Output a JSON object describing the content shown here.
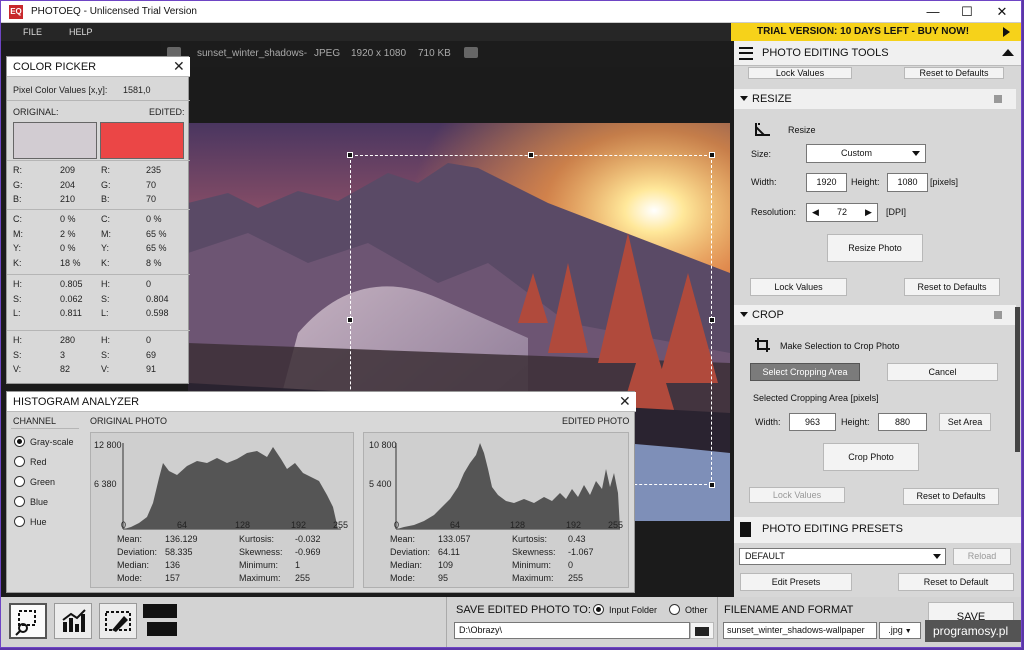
{
  "window": {
    "app_badge": "EQ",
    "title": "PHOTOEQ - Unlicensed Trial Version"
  },
  "menu": {
    "file": "FILE",
    "help": "HELP"
  },
  "trial_banner": "TRIAL VERSION: 10 DAYS LEFT - BUY NOW!",
  "file_info": {
    "name": "sunset_winter_shadows-",
    "format": "JPEG",
    "dimensions": "1920 x 1080",
    "size": "710 KB"
  },
  "color_picker": {
    "title": "COLOR PICKER",
    "pixel_label": "Pixel Color Values [x,y]:",
    "pixel_coords": "1581,0",
    "original_label": "ORIGINAL:",
    "edited_label": "EDITED:",
    "original_color": "#d2ccd2",
    "edited_color": "#eb4646",
    "groups": [
      [
        {
          "k": "R:",
          "o": "209",
          "e": "235"
        },
        {
          "k": "G:",
          "o": "204",
          "e": "70"
        },
        {
          "k": "B:",
          "o": "210",
          "e": "70"
        }
      ],
      [
        {
          "k": "C:",
          "o": "0 %",
          "e": "0 %"
        },
        {
          "k": "M:",
          "o": "2 %",
          "e": "65 %"
        },
        {
          "k": "Y:",
          "o": "0 %",
          "e": "65 %"
        },
        {
          "k": "K:",
          "o": "18 %",
          "e": "8 %"
        }
      ],
      [
        {
          "k": "H:",
          "o": "0.805",
          "e": "0"
        },
        {
          "k": "S:",
          "o": "0.062",
          "e": "0.804"
        },
        {
          "k": "L:",
          "o": "0.811",
          "e": "0.598"
        }
      ],
      [
        {
          "k": "H:",
          "o": "280",
          "e": "0"
        },
        {
          "k": "S:",
          "o": "3",
          "e": "69"
        },
        {
          "k": "V:",
          "o": "82",
          "e": "91"
        }
      ]
    ]
  },
  "histogram": {
    "title": "HISTOGRAM ANALYZER",
    "channel_label": "CHANNEL",
    "channels": [
      "Gray-scale",
      "Red",
      "Green",
      "Blue",
      "Hue"
    ],
    "selected_channel": "Gray-scale",
    "original_label": "ORIGINAL PHOTO",
    "edited_label": "EDITED PHOTO",
    "original": {
      "ymax": "12 800",
      "ymid": "6 380",
      "xticks": [
        "0",
        "64",
        "128",
        "192",
        "255"
      ],
      "stats": [
        [
          "Mean:",
          "136.129",
          "Kurtosis:",
          "-0.032"
        ],
        [
          "Deviation:",
          "58.335",
          "Skewness:",
          "-0.969"
        ],
        [
          "Median:",
          "136",
          "Minimum:",
          "1"
        ],
        [
          "Mode:",
          "157",
          "Maximum:",
          "255"
        ]
      ]
    },
    "edited": {
      "ymax": "10 800",
      "ymid": "5 400",
      "xticks": [
        "0",
        "64",
        "128",
        "192",
        "255"
      ],
      "stats": [
        [
          "Mean:",
          "133.057",
          "Kurtosis:",
          "0.43"
        ],
        [
          "Deviation:",
          "64.11",
          "Skewness:",
          "-1.067"
        ],
        [
          "Median:",
          "109",
          "Minimum:",
          "0"
        ],
        [
          "Mode:",
          "95",
          "Maximum:",
          "255"
        ]
      ]
    }
  },
  "tools_panel": {
    "title": "PHOTO EDITING TOOLS",
    "lock_values": "Lock Values",
    "reset_defaults": "Reset to Defaults",
    "resize": {
      "title": "RESIZE",
      "subtitle": "Resize",
      "size_label": "Size:",
      "size_value": "Custom",
      "width_label": "Width:",
      "width_value": "1920",
      "height_label": "Height:",
      "height_value": "1080",
      "unit": "[pixels]",
      "resolution_label": "Resolution:",
      "resolution_value": "72",
      "resolution_unit": "[DPI]",
      "action": "Resize Photo"
    },
    "crop": {
      "title": "CROP",
      "subtitle": "Make Selection to Crop Photo",
      "select_area": "Select Cropping Area",
      "cancel": "Cancel",
      "selected_label": "Selected Cropping Area [pixels]",
      "width_label": "Width:",
      "width_value": "963",
      "height_label": "Height:",
      "height_value": "880",
      "set_area": "Set Area",
      "action": "Crop Photo"
    }
  },
  "presets": {
    "title": "PHOTO EDITING PRESETS",
    "value": "DEFAULT",
    "reload": "Reload",
    "edit": "Edit Presets",
    "reset": "Reset to Default"
  },
  "save_bar": {
    "title": "SAVE EDITED PHOTO TO:",
    "input_folder": "Input Folder",
    "other": "Other",
    "path": "D:\\Obrazy\\",
    "filename_title": "FILENAME AND FORMAT",
    "filename": "sunset_winter_shadows-wallpaper",
    "format": ".jpg",
    "save": "SAVE"
  },
  "watermark": "programosy.pl"
}
